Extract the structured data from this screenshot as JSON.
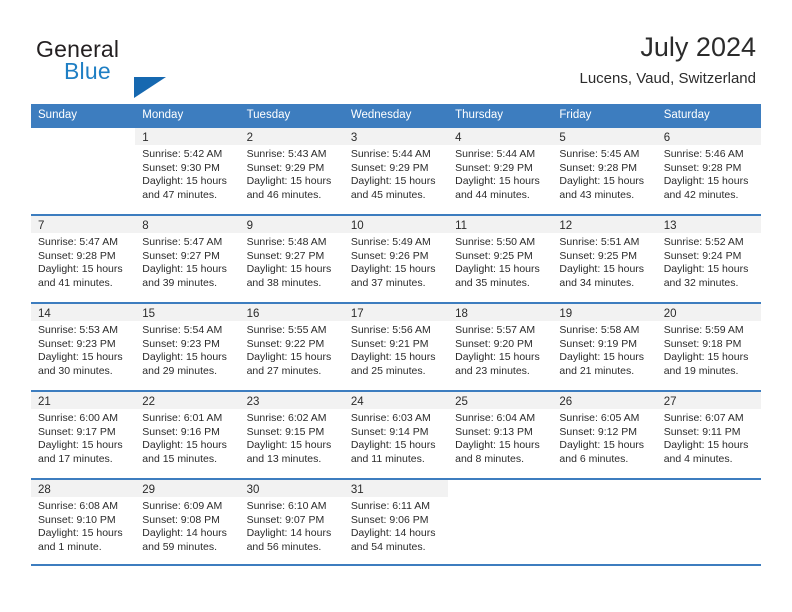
{
  "brand": {
    "name_part1": "General",
    "name_part2": "Blue",
    "logo_icon": "triangle-logo-icon"
  },
  "header": {
    "title": "July 2024",
    "subtitle": "Lucens, Vaud, Switzerland"
  },
  "colors": {
    "header_blue": "#3d7dbf",
    "brand_blue": "#1f7fc4",
    "logo_blue": "#1668b0",
    "daynum_band": "#f2f2f2",
    "text": "#2b2b2b"
  },
  "weekdays": [
    "Sunday",
    "Monday",
    "Tuesday",
    "Wednesday",
    "Thursday",
    "Friday",
    "Saturday"
  ],
  "weeks": [
    [
      {
        "day": "",
        "lines": []
      },
      {
        "day": "1",
        "lines": [
          "Sunrise: 5:42 AM",
          "Sunset: 9:30 PM",
          "Daylight: 15 hours",
          "and 47 minutes."
        ]
      },
      {
        "day": "2",
        "lines": [
          "Sunrise: 5:43 AM",
          "Sunset: 9:29 PM",
          "Daylight: 15 hours",
          "and 46 minutes."
        ]
      },
      {
        "day": "3",
        "lines": [
          "Sunrise: 5:44 AM",
          "Sunset: 9:29 PM",
          "Daylight: 15 hours",
          "and 45 minutes."
        ]
      },
      {
        "day": "4",
        "lines": [
          "Sunrise: 5:44 AM",
          "Sunset: 9:29 PM",
          "Daylight: 15 hours",
          "and 44 minutes."
        ]
      },
      {
        "day": "5",
        "lines": [
          "Sunrise: 5:45 AM",
          "Sunset: 9:28 PM",
          "Daylight: 15 hours",
          "and 43 minutes."
        ]
      },
      {
        "day": "6",
        "lines": [
          "Sunrise: 5:46 AM",
          "Sunset: 9:28 PM",
          "Daylight: 15 hours",
          "and 42 minutes."
        ]
      }
    ],
    [
      {
        "day": "7",
        "lines": [
          "Sunrise: 5:47 AM",
          "Sunset: 9:28 PM",
          "Daylight: 15 hours",
          "and 41 minutes."
        ]
      },
      {
        "day": "8",
        "lines": [
          "Sunrise: 5:47 AM",
          "Sunset: 9:27 PM",
          "Daylight: 15 hours",
          "and 39 minutes."
        ]
      },
      {
        "day": "9",
        "lines": [
          "Sunrise: 5:48 AM",
          "Sunset: 9:27 PM",
          "Daylight: 15 hours",
          "and 38 minutes."
        ]
      },
      {
        "day": "10",
        "lines": [
          "Sunrise: 5:49 AM",
          "Sunset: 9:26 PM",
          "Daylight: 15 hours",
          "and 37 minutes."
        ]
      },
      {
        "day": "11",
        "lines": [
          "Sunrise: 5:50 AM",
          "Sunset: 9:25 PM",
          "Daylight: 15 hours",
          "and 35 minutes."
        ]
      },
      {
        "day": "12",
        "lines": [
          "Sunrise: 5:51 AM",
          "Sunset: 9:25 PM",
          "Daylight: 15 hours",
          "and 34 minutes."
        ]
      },
      {
        "day": "13",
        "lines": [
          "Sunrise: 5:52 AM",
          "Sunset: 9:24 PM",
          "Daylight: 15 hours",
          "and 32 minutes."
        ]
      }
    ],
    [
      {
        "day": "14",
        "lines": [
          "Sunrise: 5:53 AM",
          "Sunset: 9:23 PM",
          "Daylight: 15 hours",
          "and 30 minutes."
        ]
      },
      {
        "day": "15",
        "lines": [
          "Sunrise: 5:54 AM",
          "Sunset: 9:23 PM",
          "Daylight: 15 hours",
          "and 29 minutes."
        ]
      },
      {
        "day": "16",
        "lines": [
          "Sunrise: 5:55 AM",
          "Sunset: 9:22 PM",
          "Daylight: 15 hours",
          "and 27 minutes."
        ]
      },
      {
        "day": "17",
        "lines": [
          "Sunrise: 5:56 AM",
          "Sunset: 9:21 PM",
          "Daylight: 15 hours",
          "and 25 minutes."
        ]
      },
      {
        "day": "18",
        "lines": [
          "Sunrise: 5:57 AM",
          "Sunset: 9:20 PM",
          "Daylight: 15 hours",
          "and 23 minutes."
        ]
      },
      {
        "day": "19",
        "lines": [
          "Sunrise: 5:58 AM",
          "Sunset: 9:19 PM",
          "Daylight: 15 hours",
          "and 21 minutes."
        ]
      },
      {
        "day": "20",
        "lines": [
          "Sunrise: 5:59 AM",
          "Sunset: 9:18 PM",
          "Daylight: 15 hours",
          "and 19 minutes."
        ]
      }
    ],
    [
      {
        "day": "21",
        "lines": [
          "Sunrise: 6:00 AM",
          "Sunset: 9:17 PM",
          "Daylight: 15 hours",
          "and 17 minutes."
        ]
      },
      {
        "day": "22",
        "lines": [
          "Sunrise: 6:01 AM",
          "Sunset: 9:16 PM",
          "Daylight: 15 hours",
          "and 15 minutes."
        ]
      },
      {
        "day": "23",
        "lines": [
          "Sunrise: 6:02 AM",
          "Sunset: 9:15 PM",
          "Daylight: 15 hours",
          "and 13 minutes."
        ]
      },
      {
        "day": "24",
        "lines": [
          "Sunrise: 6:03 AM",
          "Sunset: 9:14 PM",
          "Daylight: 15 hours",
          "and 11 minutes."
        ]
      },
      {
        "day": "25",
        "lines": [
          "Sunrise: 6:04 AM",
          "Sunset: 9:13 PM",
          "Daylight: 15 hours",
          "and 8 minutes."
        ]
      },
      {
        "day": "26",
        "lines": [
          "Sunrise: 6:05 AM",
          "Sunset: 9:12 PM",
          "Daylight: 15 hours",
          "and 6 minutes."
        ]
      },
      {
        "day": "27",
        "lines": [
          "Sunrise: 6:07 AM",
          "Sunset: 9:11 PM",
          "Daylight: 15 hours",
          "and 4 minutes."
        ]
      }
    ],
    [
      {
        "day": "28",
        "lines": [
          "Sunrise: 6:08 AM",
          "Sunset: 9:10 PM",
          "Daylight: 15 hours",
          "and 1 minute."
        ]
      },
      {
        "day": "29",
        "lines": [
          "Sunrise: 6:09 AM",
          "Sunset: 9:08 PM",
          "Daylight: 14 hours",
          "and 59 minutes."
        ]
      },
      {
        "day": "30",
        "lines": [
          "Sunrise: 6:10 AM",
          "Sunset: 9:07 PM",
          "Daylight: 14 hours",
          "and 56 minutes."
        ]
      },
      {
        "day": "31",
        "lines": [
          "Sunrise: 6:11 AM",
          "Sunset: 9:06 PM",
          "Daylight: 14 hours",
          "and 54 minutes."
        ]
      },
      {
        "day": "",
        "lines": []
      },
      {
        "day": "",
        "lines": []
      },
      {
        "day": "",
        "lines": []
      }
    ]
  ]
}
